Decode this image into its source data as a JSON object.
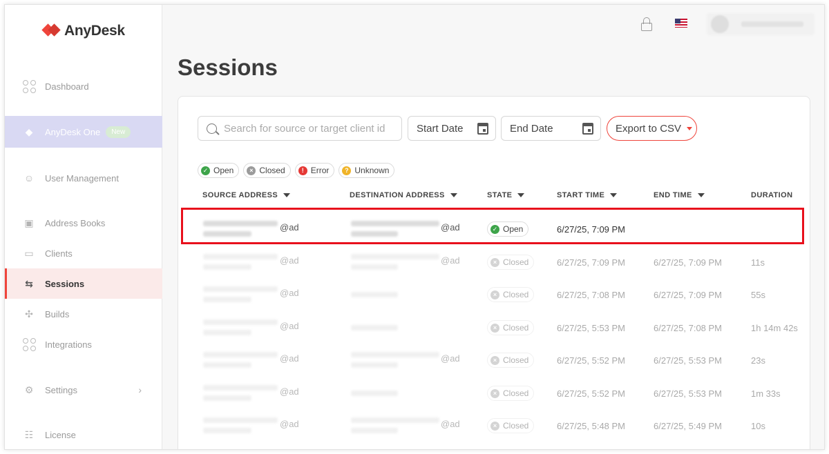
{
  "brand": {
    "name": "AnyDesk"
  },
  "sidebar": {
    "items": [
      {
        "label": "Dashboard",
        "icon": "dashboard-icon"
      },
      {
        "label": "AnyDesk One",
        "badge": "New",
        "icon": "anydesk-one-icon"
      },
      {
        "label": "User Management",
        "icon": "user-icon"
      },
      {
        "label": "Address Books",
        "icon": "address-book-icon"
      },
      {
        "label": "Clients",
        "icon": "monitor-icon"
      },
      {
        "label": "Sessions",
        "icon": "sessions-icon"
      },
      {
        "label": "Builds",
        "icon": "builds-icon"
      },
      {
        "label": "Integrations",
        "icon": "integrations-icon"
      },
      {
        "label": "Settings",
        "icon": "settings-icon"
      },
      {
        "label": "License",
        "icon": "license-icon"
      }
    ],
    "active": "Sessions"
  },
  "page": {
    "title": "Sessions"
  },
  "toolbar": {
    "search_placeholder": "Search for source or target client id",
    "start_date": "Start Date",
    "end_date": "End Date",
    "export_label": "Export to CSV"
  },
  "filters": [
    {
      "label": "Open",
      "status": "open"
    },
    {
      "label": "Closed",
      "status": "closed"
    },
    {
      "label": "Error",
      "status": "error"
    },
    {
      "label": "Unknown",
      "status": "unknown"
    }
  ],
  "table": {
    "columns": [
      "SOURCE ADDRESS",
      "DESTINATION ADDRESS",
      "STATE",
      "START TIME",
      "END TIME",
      "DURATION"
    ],
    "address_suffix": "@ad",
    "rows": [
      {
        "state": "Open",
        "start": "6/27/25, 7:09 PM",
        "end": "",
        "duration": ""
      },
      {
        "state": "Closed",
        "start": "6/27/25, 7:09 PM",
        "end": "6/27/25, 7:09 PM",
        "duration": "11s"
      },
      {
        "state": "Closed",
        "start": "6/27/25, 7:08 PM",
        "end": "6/27/25, 7:09 PM",
        "duration": "55s"
      },
      {
        "state": "Closed",
        "start": "6/27/25, 5:53 PM",
        "end": "6/27/25, 7:08 PM",
        "duration": "1h 14m 42s"
      },
      {
        "state": "Closed",
        "start": "6/27/25, 5:52 PM",
        "end": "6/27/25, 5:53 PM",
        "duration": "23s"
      },
      {
        "state": "Closed",
        "start": "6/27/25, 5:52 PM",
        "end": "6/27/25, 5:53 PM",
        "duration": "1m 33s"
      },
      {
        "state": "Closed",
        "start": "6/27/25, 5:48 PM",
        "end": "6/27/25, 5:49 PM",
        "duration": "10s"
      }
    ]
  },
  "colors": {
    "accent": "#ef443b",
    "open": "#3ea44a",
    "highlight": "#e8101c"
  }
}
